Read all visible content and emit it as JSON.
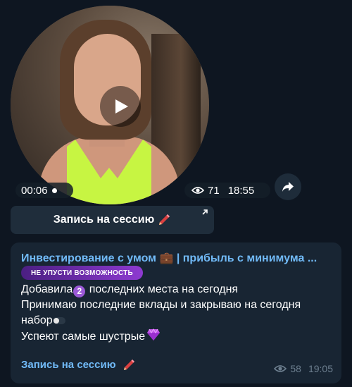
{
  "video_message": {
    "duration": "00:06",
    "views": "71",
    "time": "18:55"
  },
  "inline_button": {
    "label": "Запись на сессию"
  },
  "post": {
    "channel_title": "Инвестирование с умом 💼 | прибыль с минимума ...",
    "promo_badge": "НЕ УПУСТИ ВОЗМОЖНОСТЬ",
    "line1_before": "Добавила",
    "line1_number": "2",
    "line1_after": "последних места на сегодня",
    "line2": "Принимаю последние вклады и закрываю на сегодня",
    "line3": "набор",
    "line4": "Успеют самые шустрые",
    "link_label": "Запись на сессию",
    "views": "58",
    "time": "19:05"
  },
  "icons": {
    "play": "play-icon",
    "share": "share-arrow-icon",
    "eye": "eye-icon",
    "pen": "pen-icon",
    "external": "external-link-arrow-icon",
    "gem": "gem-icon"
  },
  "colors": {
    "background": "#0e1621",
    "bubble": "#182533",
    "link": "#71baf7",
    "badge": "#8e3ad1",
    "meta": "#6d7f8f"
  }
}
